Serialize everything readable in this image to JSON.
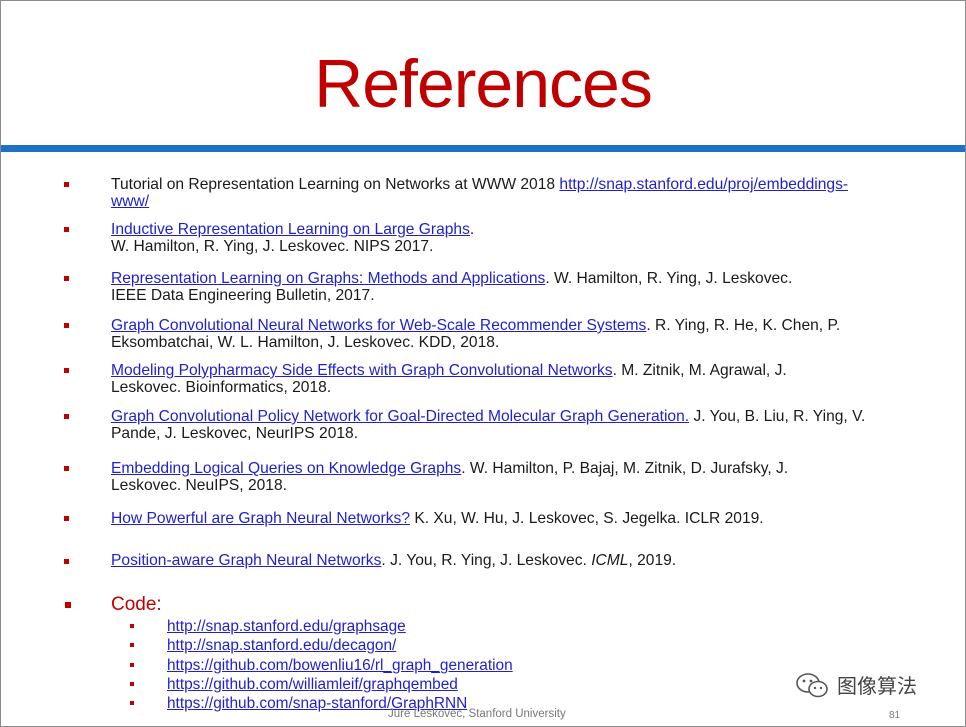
{
  "title": "References",
  "refs": [
    {
      "pre": "Tutorial on Representation Learning on Networks at WWW 2018 ",
      "link": "http://snap.stanford.edu/proj/embeddings-",
      "post": "",
      "line2_link": "www/",
      "line2": ""
    },
    {
      "pre": "",
      "link": "Inductive Representation Learning on Large Graphs",
      "post": ".",
      "line2_link": "",
      "line2": "W. Hamilton, R. Ying, J. Leskovec. NIPS 2017."
    },
    {
      "pre": "",
      "link": "Representation Learning on Graphs: Methods and Applications",
      "post": ". W. Hamilton, R. Ying, J. Leskovec.",
      "line2_link": "",
      "line2": "IEEE Data Engineering Bulletin, 2017."
    },
    {
      "pre": "",
      "link": "Graph Convolutional Neural Networks for Web-Scale Recommender Systems",
      "post": ". R. Ying, R. He, K. Chen, P.",
      "line2_link": "",
      "line2": "Eksombatchai, W. L. Hamilton, J. Leskovec. KDD, 2018."
    },
    {
      "pre": "",
      "link": "Modeling Polypharmacy Side Effects with Graph Convolutional Networks",
      "post": ". M. Zitnik, M. Agrawal, J.",
      "line2_link": "",
      "line2": "Leskovec. Bioinformatics, 2018."
    },
    {
      "pre": "",
      "link": "Graph Convolutional Policy Network for Goal-Directed Molecular Graph Generation.",
      "post": " J. You, B. Liu, R. Ying, V.",
      "line2_link": "",
      "line2": "Pande, J. Leskovec, NeurIPS 2018."
    },
    {
      "pre": "",
      "link": "Embedding Logical Queries on Knowledge Graphs",
      "post": ". W. Hamilton, P. Bajaj, M. Zitnik, D. Jurafsky, J.",
      "line2_link": "",
      "line2": "Leskovec. NeuIPS, 2018."
    },
    {
      "pre": "",
      "link": "How Powerful are Graph Neural Networks?",
      "post": " K. Xu, W. Hu, J. Leskovec, S. Jegelka. ICLR 2019.",
      "line2_link": "",
      "line2": ""
    },
    {
      "pre": "",
      "link": "Position-aware Graph Neural Networks",
      "post": ". J. You, R. Ying, J. Leskovec. ",
      "italic": "ICML",
      "post2": ", 2019.",
      "line2_link": "",
      "line2": ""
    }
  ],
  "code_heading": "Code:",
  "code_links": [
    "http://snap.stanford.edu/graphsage",
    "http://snap.stanford.edu/decagon/",
    "https://github.com/bowenliu16/rl_graph_generation",
    "https://github.com/williamleif/graphqembed",
    "https://github.com/snap-stanford/GraphRNN"
  ],
  "footer": "Jure Leskovec, Stanford University",
  "page_number": "81",
  "watermark": "图像算法",
  "colors": {
    "title": "#c00000",
    "rule": "#1f72c3",
    "link": "#1f1fcf",
    "bullet": "#c00000"
  }
}
